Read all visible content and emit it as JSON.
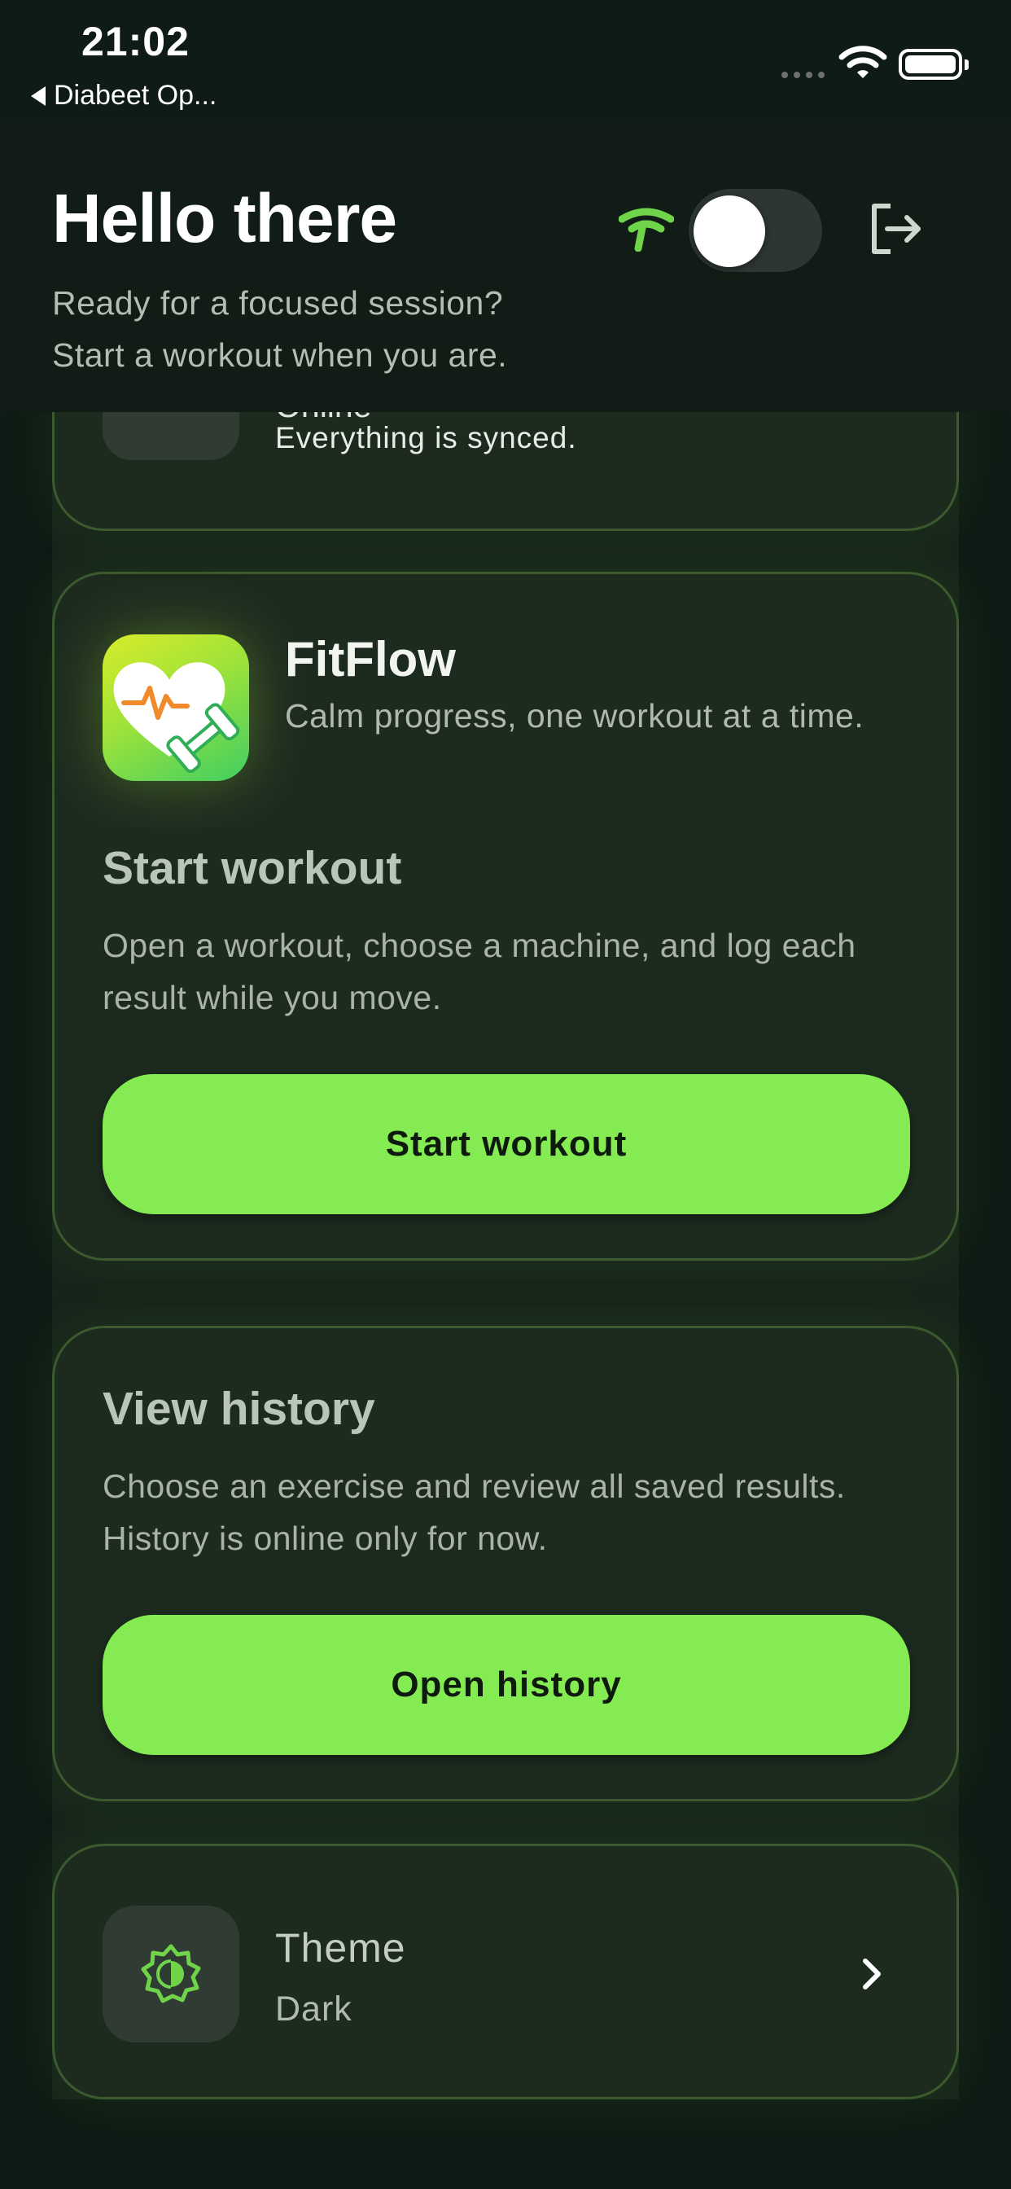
{
  "status_bar": {
    "time": "21:02",
    "back_app": "Diabeet Op..."
  },
  "header": {
    "title": "Hello there",
    "subtitle_line1": "Ready for a focused session?",
    "subtitle_line2": "Start a workout when you are.",
    "sync_icon": "signal-icon",
    "logout_icon": "logout-icon"
  },
  "sync_status": {
    "title": "Online",
    "message": "Everything is synced."
  },
  "workout_card": {
    "app_name": "FitFlow",
    "app_tagline": "Calm progress, one workout at a time.",
    "section_title": "Start workout",
    "description": "Open a workout, choose a machine, and log each result while you move.",
    "button_label": "Start workout"
  },
  "history_card": {
    "section_title": "View history",
    "description": "Choose an exercise and review all saved results. History is online only for now.",
    "button_label": "Open history"
  },
  "theme_card": {
    "title": "Theme",
    "value": "Dark"
  },
  "colors": {
    "accent": "#84ec52",
    "background": "#0f1b15",
    "card": "#1d2b1f",
    "card_border": "#3b5a2e"
  }
}
